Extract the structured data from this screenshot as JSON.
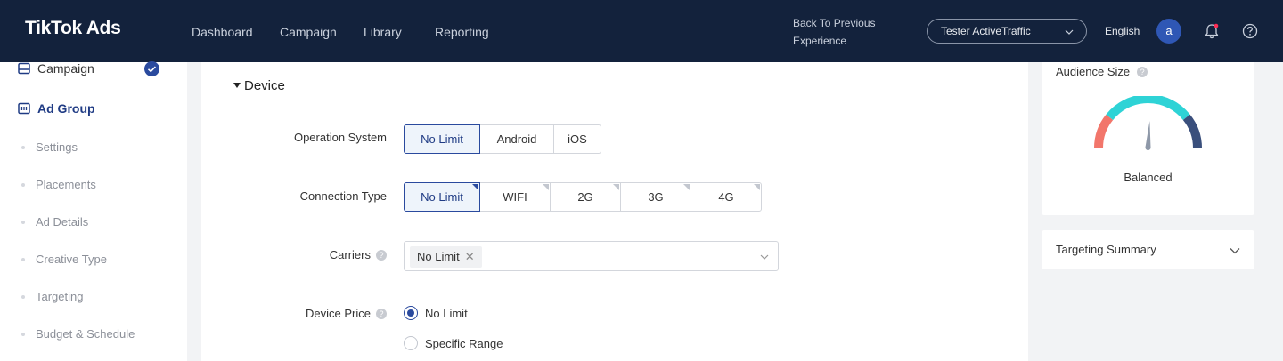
{
  "header": {
    "logo": "TikTok Ads",
    "nav": [
      "Dashboard",
      "Campaign",
      "Library",
      "Reporting"
    ],
    "back_link": "Back To Previous Experience",
    "account": "Tester ActiveTraffic",
    "language": "English",
    "avatar_initial": "a"
  },
  "sidebar": {
    "campaign": "Campaign",
    "ad_group": "Ad Group",
    "sub_items": [
      "Settings",
      "Placements",
      "Ad Details",
      "Creative Type",
      "Targeting",
      "Budget & Schedule"
    ]
  },
  "device": {
    "title": "Device",
    "os_label": "Operation System",
    "os_options": [
      "No Limit",
      "Android",
      "iOS"
    ],
    "os_selected": "No Limit",
    "conn_label": "Connection Type",
    "conn_options": [
      "No Limit",
      "WIFI",
      "2G",
      "3G",
      "4G"
    ],
    "conn_selected": "No Limit",
    "carriers_label": "Carriers",
    "carriers_tag": "No Limit",
    "price_label": "Device Price",
    "price_options": [
      "No Limit",
      "Specific Range"
    ],
    "price_selected": "No Limit"
  },
  "audience": {
    "title": "Audience Size",
    "status": "Balanced",
    "level": 0.52
  },
  "summary": {
    "title": "Targeting Summary"
  },
  "colors": {
    "header_bg": "#13223c",
    "accent": "#2a4a9e",
    "gauge_red": "#f2766b",
    "gauge_teal": "#2ed3d6",
    "gauge_navy": "#3a4f7c"
  }
}
